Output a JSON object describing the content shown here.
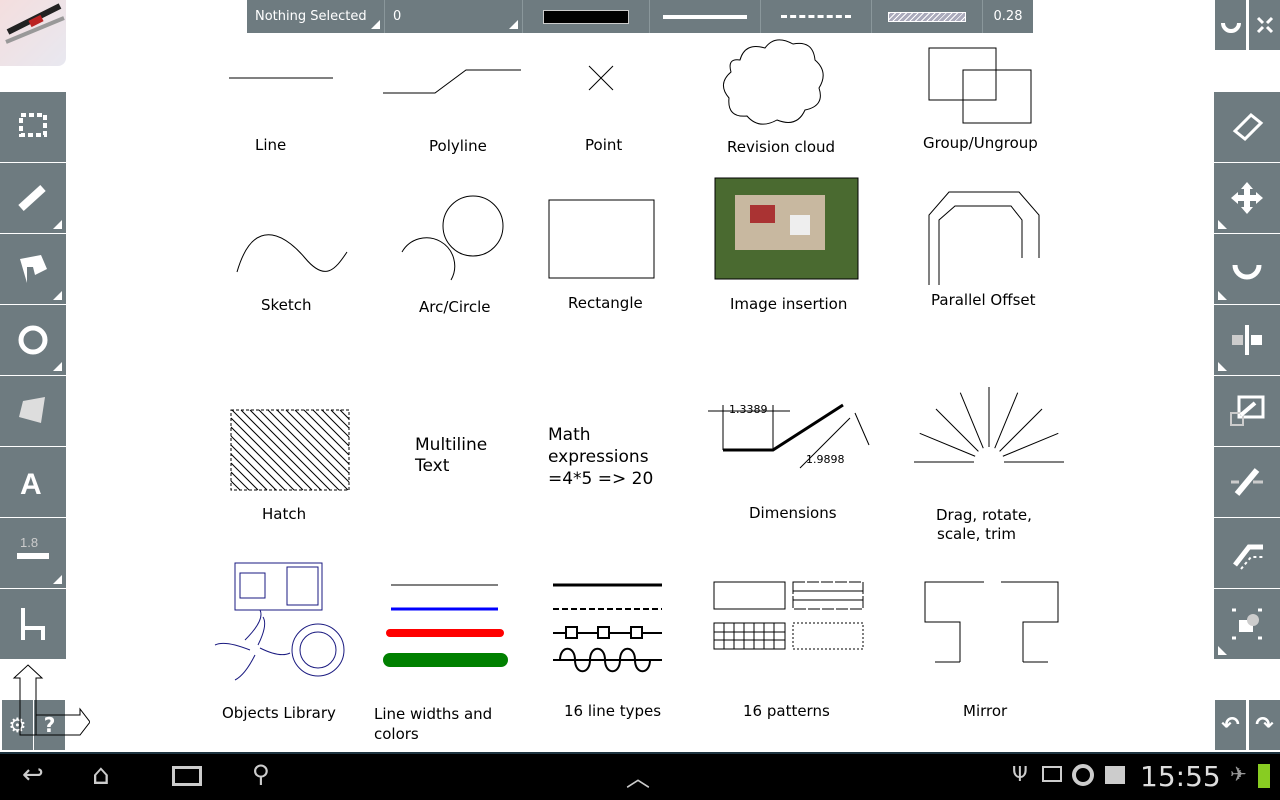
{
  "toolbar": {
    "selection": "Nothing Selected",
    "layer": "0",
    "color": "#000000",
    "line_width_value": "0.28"
  },
  "captions": {
    "line": "Line",
    "polyline": "Polyline",
    "point": "Point",
    "revision_cloud": "Revision cloud",
    "group": "Group/Ungroup",
    "sketch": "Sketch",
    "arc_circle": "Arc/Circle",
    "rectangle": "Rectangle",
    "image": "Image insertion",
    "offset": "Parallel Offset",
    "hatch": "Hatch",
    "multiline1": "Multiline",
    "multiline2": "Text",
    "math1": "Math",
    "math2": "expressions",
    "math3": "=4*5 => 20",
    "dimensions": "Dimensions",
    "dim1": "1.3389",
    "dim2": "1.9898",
    "drag1": "Drag, rotate,",
    "drag2": "scale, trim",
    "objects": "Objects Library",
    "widths1": "Line widths and",
    "widths2": "colors",
    "linetypes": "16 line types",
    "patterns": "16 patterns",
    "mirror": "Mirror"
  },
  "left_tools": [
    "select",
    "line",
    "polyline",
    "circle",
    "hatch",
    "text",
    "line-width",
    "dimension"
  ],
  "line_width_icon_label": "1.8",
  "right_tools": [
    "erase",
    "move",
    "rotate",
    "mirror",
    "scale",
    "trim",
    "offset",
    "group"
  ],
  "status": {
    "time": "15:55"
  },
  "colors": {
    "toolbar": "#6e7b80",
    "blue": "#0000ff",
    "red": "#ff0000",
    "green": "#008000",
    "navy": "#1a1a80"
  }
}
